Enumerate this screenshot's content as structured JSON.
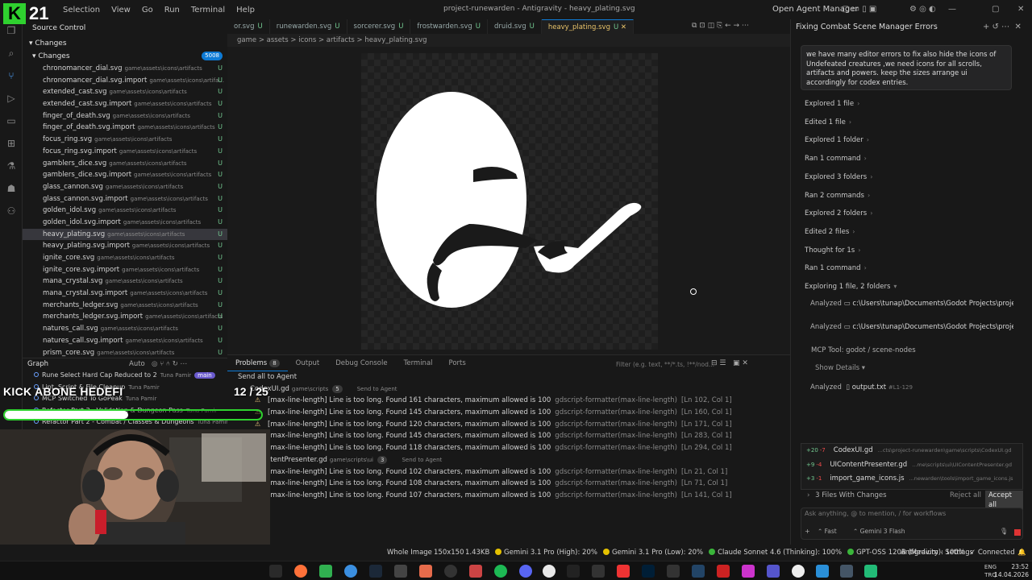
{
  "window": {
    "menu": [
      "Selection",
      "View",
      "Go",
      "Run",
      "Terminal",
      "Help"
    ],
    "title": "project-runewarden - Antigravity - heavy_plating.svg",
    "open_agent_manager": "Open Agent Manager"
  },
  "overlay": {
    "logo_letter": "K",
    "logo_number": "21",
    "kick_label": "KICK ABONE HEDEFI",
    "kick_count": "12 / 25",
    "kick_progress": 0.48
  },
  "sidebar": {
    "title": "Source Control",
    "changes_header": "Changes",
    "changes_row": "Changes",
    "changes_count": "5008",
    "files": [
      {
        "name": "chronomancer_dial.svg",
        "path": "game\\assets\\icons\\artifacts",
        "status": "U"
      },
      {
        "name": "chronomancer_dial.svg.import",
        "path": "game\\assets\\icons\\artifa...",
        "status": "U"
      },
      {
        "name": "extended_cast.svg",
        "path": "game\\assets\\icons\\artifacts",
        "status": "U"
      },
      {
        "name": "extended_cast.svg.import",
        "path": "game\\assets\\icons\\artifacts",
        "status": "U"
      },
      {
        "name": "finger_of_death.svg",
        "path": "game\\assets\\icons\\artifacts",
        "status": "U"
      },
      {
        "name": "finger_of_death.svg.import",
        "path": "game\\assets\\icons\\artifacts",
        "status": "U"
      },
      {
        "name": "focus_ring.svg",
        "path": "game\\assets\\icons\\artifacts",
        "status": "U"
      },
      {
        "name": "focus_ring.svg.import",
        "path": "game\\assets\\icons\\artifacts",
        "status": "U"
      },
      {
        "name": "gamblers_dice.svg",
        "path": "game\\assets\\icons\\artifacts",
        "status": "U"
      },
      {
        "name": "gamblers_dice.svg.import",
        "path": "game\\assets\\icons\\artifacts",
        "status": "U"
      },
      {
        "name": "glass_cannon.svg",
        "path": "game\\assets\\icons\\artifacts",
        "status": "U"
      },
      {
        "name": "glass_cannon.svg.import",
        "path": "game\\assets\\icons\\artifacts",
        "status": "U"
      },
      {
        "name": "golden_idol.svg",
        "path": "game\\assets\\icons\\artifacts",
        "status": "U"
      },
      {
        "name": "golden_idol.svg.import",
        "path": "game\\assets\\icons\\artifacts",
        "status": "U"
      },
      {
        "name": "heavy_plating.svg",
        "path": "game\\assets\\icons\\artifacts",
        "status": "U"
      },
      {
        "name": "heavy_plating.svg.import",
        "path": "game\\assets\\icons\\artifacts",
        "status": "U"
      },
      {
        "name": "ignite_core.svg",
        "path": "game\\assets\\icons\\artifacts",
        "status": "U"
      },
      {
        "name": "ignite_core.svg.import",
        "path": "game\\assets\\icons\\artifacts",
        "status": "U"
      },
      {
        "name": "mana_crystal.svg",
        "path": "game\\assets\\icons\\artifacts",
        "status": "U"
      },
      {
        "name": "mana_crystal.svg.import",
        "path": "game\\assets\\icons\\artifacts",
        "status": "U"
      },
      {
        "name": "merchants_ledger.svg",
        "path": "game\\assets\\icons\\artifacts",
        "status": "U"
      },
      {
        "name": "merchants_ledger.svg.import",
        "path": "game\\assets\\icons\\artifacts",
        "status": "U"
      },
      {
        "name": "natures_call.svg",
        "path": "game\\assets\\icons\\artifacts",
        "status": "U"
      },
      {
        "name": "natures_call.svg.import",
        "path": "game\\assets\\icons\\artifacts",
        "status": "U"
      },
      {
        "name": "prism_core.svg",
        "path": "game\\assets\\icons\\artifacts",
        "status": "U"
      }
    ],
    "selected_index": 14
  },
  "graph": {
    "title": "Graph",
    "mode": "Auto",
    "branch": "main",
    "commits": [
      {
        "msg": "Rune Select Hard Cap Reduced to 2",
        "author": "Tuna Pamir"
      },
      {
        "msg": "Lint, Script & File Cleanup",
        "author": "Tuna Pamir"
      },
      {
        "msg": "MCP Switched To GoPeak",
        "author": "Tuna Pamir"
      },
      {
        "msg": "Refactor Part 3 - Validation & Dungeon Pass",
        "author": "Tuna Pamir"
      },
      {
        "msg": "Refactor Part 2 - Combat / Classes & Dungeons",
        "author": "Tuna Pamir"
      }
    ]
  },
  "tabs": [
    {
      "label": "or.svg",
      "u": "U"
    },
    {
      "label": "runewarden.svg",
      "u": "U"
    },
    {
      "label": "sorcerer.svg",
      "u": "U"
    },
    {
      "label": "frostwarden.svg",
      "u": "U"
    },
    {
      "label": "druid.svg",
      "u": "U"
    },
    {
      "label": "heavy_plating.svg",
      "u": "U",
      "active": true
    }
  ],
  "breadcrumb": "game > assets > icons > artifacts > heavy_plating.svg",
  "panel": {
    "tabs": [
      "Problems",
      "Output",
      "Debug Console",
      "Terminal",
      "Ports"
    ],
    "problems_count": "8",
    "filter_placeholder": "Filter (e.g. text, **/*.ts, !**/nod...",
    "send_all": "Send all to Agent",
    "files": [
      {
        "name": "CodexUI.gd",
        "path": "game\\scripts",
        "count": "5",
        "send": "Send to Agent",
        "items": [
          {
            "msg": "[max-line-length] Line is too long. Found 161 characters, maximum allowed is 100",
            "src": "gdscript-formatter(max-line-length)",
            "loc": "[Ln 102, Col 1]"
          },
          {
            "msg": "[max-line-length] Line is too long. Found 145 characters, maximum allowed is 100",
            "src": "gdscript-formatter(max-line-length)",
            "loc": "[Ln 160, Col 1]"
          },
          {
            "msg": "[max-line-length] Line is too long. Found 120 characters, maximum allowed is 100",
            "src": "gdscript-formatter(max-line-length)",
            "loc": "[Ln 171, Col 1]"
          },
          {
            "msg": "[max-line-length] Line is too long. Found 145 characters, maximum allowed is 100",
            "src": "gdscript-formatter(max-line-length)",
            "loc": "[Ln 283, Col 1]"
          },
          {
            "msg": "[max-line-length] Line is too long. Found 118 characters, maximum allowed is 100",
            "src": "gdscript-formatter(max-line-length)",
            "loc": "[Ln 294, Col 1]"
          }
        ]
      },
      {
        "name": "UIContentPresenter.gd",
        "path": "game\\scripts\\ui",
        "count": "3",
        "send": "Send to Agent",
        "items": [
          {
            "msg": "[max-line-length] Line is too long. Found 102 characters, maximum allowed is 100",
            "src": "gdscript-formatter(max-line-length)",
            "loc": "[Ln 21, Col 1]"
          },
          {
            "msg": "[max-line-length] Line is too long. Found 108 characters, maximum allowed is 100",
            "src": "gdscript-formatter(max-line-length)",
            "loc": "[Ln 71, Col 1]"
          },
          {
            "msg": "[max-line-length] Line is too long. Found 107 characters, maximum allowed is 100",
            "src": "gdscript-formatter(max-line-length)",
            "loc": "[Ln 141, Col 1]"
          }
        ]
      }
    ]
  },
  "chat": {
    "title": "Fixing Combat Scene Manager Errors",
    "prompt": "we have many editor errors to fix also hide the icons of Undefeated creatures ,we need icons for all scrolls, artifacts and powers. keep the sizes arrange ui accordingly for codex entries.",
    "steps": [
      "Explored 1 file",
      "Edited 1 file",
      "Explored 1 folder",
      "Ran 1 command",
      "Explored 3 folders",
      "Ran 2 commands",
      "Explored 2 folders",
      "Edited 2 files",
      "Thought for 1s",
      "Ran 1 command",
      "Exploring 1 file, 2 folders"
    ],
    "analyzed": [
      {
        "label": "Analyzed",
        "value": "c:\\Users\\tunap\\Documents\\Godot Projects\\projec"
      },
      {
        "label": "Analyzed",
        "value": "c:\\Users\\tunap\\Documents\\Godot Projects\\projec"
      }
    ],
    "mcp": "MCP Tool: godot / scene-nodes",
    "show_details": "Show Details",
    "output_label": "Analyzed",
    "output_file": "output.txt",
    "output_range": "#L1-129",
    "changed_files": [
      {
        "plus": "+20",
        "minus": "-7",
        "name": "CodexUI.gd",
        "path": "...cts\\project-runewarden\\game\\scripts\\CodexUI.gd"
      },
      {
        "plus": "+9",
        "minus": "-4",
        "name": "UIContentPresenter.gd",
        "path": "...me\\scripts\\ui\\UIContentPresenter.gd"
      },
      {
        "plus": "+3",
        "minus": "-1",
        "name": "import_game_icons.js",
        "path": "...newarden\\tools\\import_game_icons.js"
      }
    ],
    "files_with_changes": "3 Files With Changes",
    "reject_all": "Reject all",
    "accept_all": "Accept all",
    "ask_placeholder": "Ask anything, @ to mention, / for workflows",
    "mode": "Fast",
    "model": "Gemini 3 Flash"
  },
  "statusbar": {
    "view": "Whole Image",
    "dims": "150x150",
    "size": "1.43KB",
    "quotas": [
      {
        "label": "Gemini 3.1 Pro (High): 20%",
        "color": "#e5c100"
      },
      {
        "label": "Gemini 3.1 Pro (Low): 20%",
        "color": "#e5c100"
      },
      {
        "label": "Claude Sonnet 4.6 (Thinking): 100%",
        "color": "#3ab53a"
      },
      {
        "label": "GPT-OSS 120B (Medium): 100%",
        "color": "#3ab53a"
      }
    ],
    "settings": "Antigravity - Settings",
    "connection": "Connected"
  },
  "taskbar": {
    "lang1": "ENG",
    "lang2": "TRQ",
    "time": "23:52",
    "date": "14.04.2026"
  }
}
